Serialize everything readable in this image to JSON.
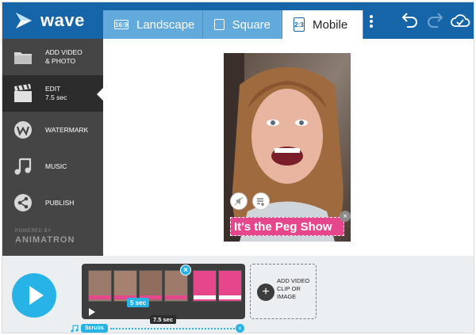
{
  "app": {
    "name": "wave"
  },
  "format_tabs": [
    {
      "label": "Landscape",
      "icon_text": "16:9"
    },
    {
      "label": "Square",
      "icon_text": ""
    },
    {
      "label": "Mobile",
      "icon_text": "2:3"
    }
  ],
  "active_format": "Mobile",
  "sidebar": {
    "items": [
      {
        "label": "ADD VIDEO",
        "label2": "& PHOTO",
        "icon": "folder-icon"
      },
      {
        "label": "EDIT",
        "sub": "7.5 sec",
        "icon": "clapperboard-icon"
      },
      {
        "label": "WATERMARK",
        "icon": "watermark-icon"
      },
      {
        "label": "MUSIC",
        "icon": "music-note-icon"
      },
      {
        "label": "PUBLISH",
        "icon": "share-icon"
      }
    ],
    "powered_by": "POWERED BY",
    "brand": "ANIMATRON"
  },
  "canvas": {
    "caption_text": "It's the Peg Show"
  },
  "timeline": {
    "clip_duration": "5 sec",
    "total_duration": "7.5 sec",
    "add_clip_label": "ADD VIDEO CLIP OR IMAGE",
    "music_track": "Scrubs"
  },
  "colors": {
    "topbar": "#1565a8",
    "accent": "#27b3e6",
    "caption_bg": "#e6468c",
    "sidebar": "#454545"
  }
}
